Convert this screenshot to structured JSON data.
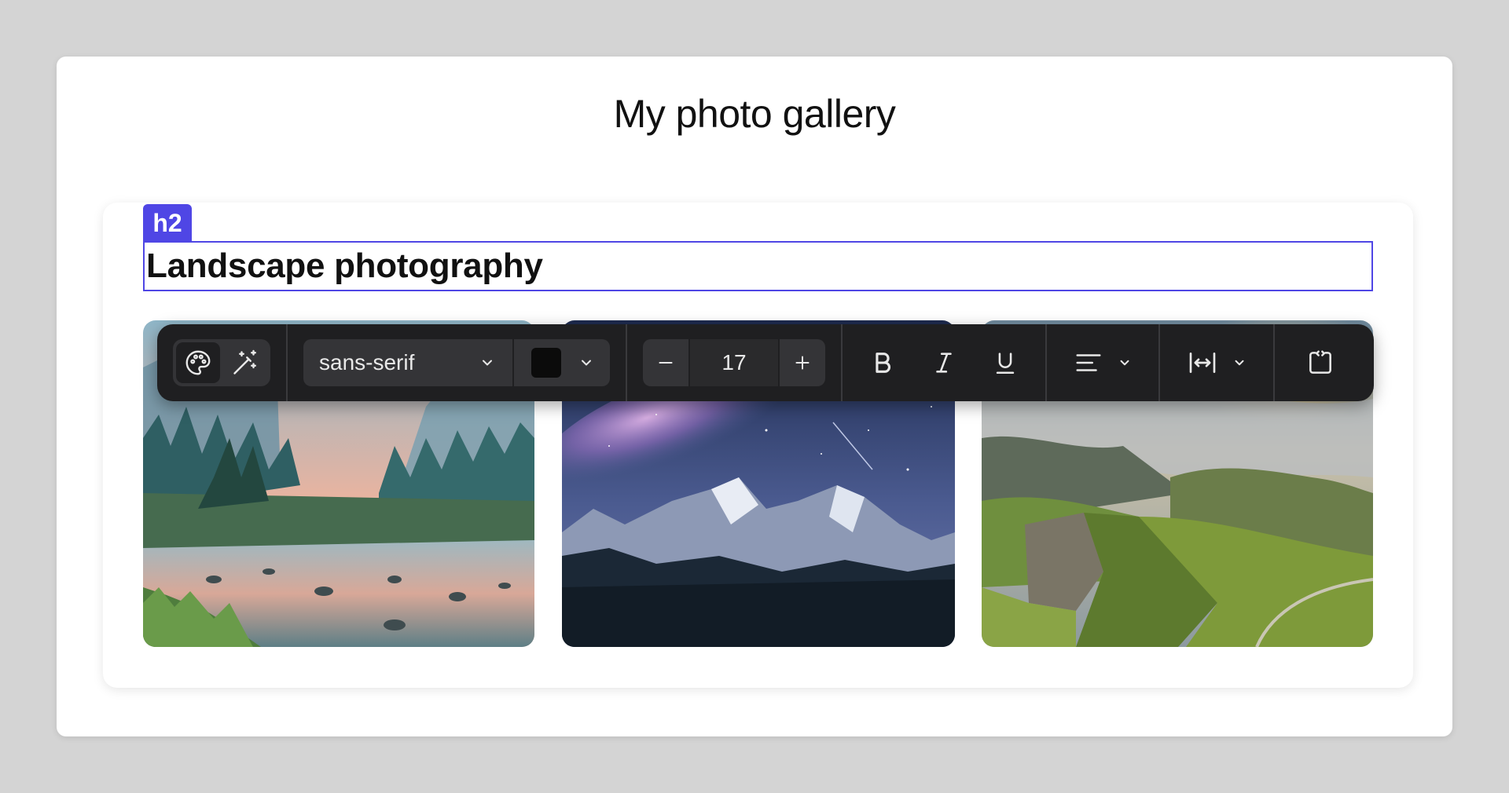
{
  "page": {
    "title": "My photo gallery"
  },
  "section": {
    "tag_label": "h2",
    "heading": "Landscape photography"
  },
  "toolbar": {
    "font_family": "sans-serif",
    "text_color": "#0b0b0b",
    "font_size": "17",
    "icons": {
      "style_mode": "palette-icon",
      "ai_mode": "magic-wand-icon",
      "font_dropdown": "chevron-down-icon",
      "color_dropdown": "chevron-down-icon",
      "decrease": "minus-icon",
      "increase": "plus-icon",
      "bold": "bold-icon",
      "italic": "italic-icon",
      "underline": "underline-icon",
      "align": "align-left-icon",
      "spacing": "letter-spacing-icon",
      "code": "code-block-icon"
    }
  },
  "photos": [
    {
      "subject": "forest-river-valley"
    },
    {
      "subject": "starry-mountain-night"
    },
    {
      "subject": "green-cliffs-sunset"
    }
  ],
  "colors": {
    "accent": "#4f46e5",
    "toolbar_bg": "#1f1f21",
    "toolbar_control": "#343437"
  }
}
